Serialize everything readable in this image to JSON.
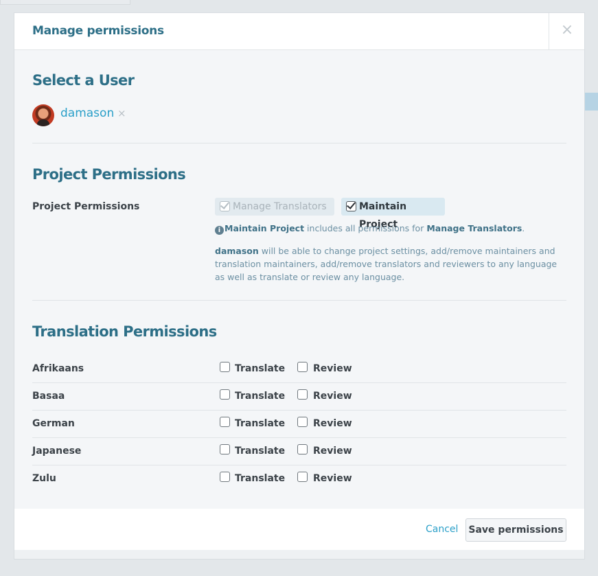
{
  "modal": {
    "title": "Manage permissions",
    "close_icon": "close-icon"
  },
  "select_user": {
    "heading": "Select a User",
    "username": "damason",
    "remove_icon": "×"
  },
  "project_permissions": {
    "heading": "Project Permissions",
    "row_label": "Project Permissions",
    "options": [
      {
        "label": "Manage Translators",
        "checked": true,
        "disabled": true
      },
      {
        "label": "Maintain Project",
        "checked": true,
        "disabled": false
      }
    ],
    "info_main": "Maintain Project",
    "info_text": " includes all permissions for ",
    "info_ref": "Manage Translators",
    "info_end": ".",
    "desc_user": "damason",
    "desc_text": " will be able to change project settings, add/remove maintainers and translation maintainers, add/remove translators and reviewers to any language as well as translate or review any language."
  },
  "translation_permissions": {
    "heading": "Translation Permissions",
    "translate_label": "Translate",
    "review_label": "Review",
    "languages": [
      {
        "name": "Afrikaans",
        "translate": false,
        "review": false
      },
      {
        "name": "Basaa",
        "translate": false,
        "review": false
      },
      {
        "name": "German",
        "translate": false,
        "review": false
      },
      {
        "name": "Japanese",
        "translate": false,
        "review": false
      },
      {
        "name": "Zulu",
        "translate": false,
        "review": false
      }
    ]
  },
  "footer": {
    "cancel_label": "Cancel",
    "save_label": "Save permissions"
  },
  "colors": {
    "heading": "#2d6f87",
    "link": "#2a9fc8",
    "background": "#e3e7ea"
  }
}
